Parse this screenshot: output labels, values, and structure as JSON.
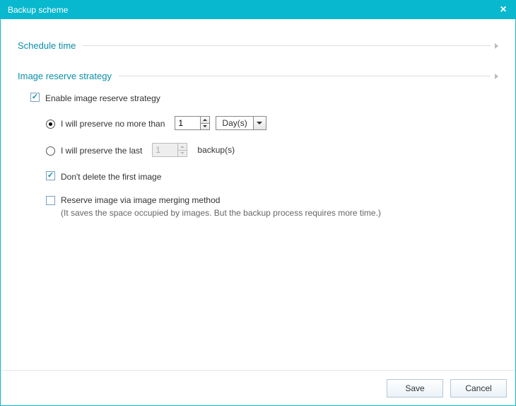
{
  "window": {
    "title": "Backup scheme"
  },
  "sections": {
    "schedule": {
      "title": "Schedule time"
    },
    "reserve": {
      "title": "Image reserve strategy",
      "enable_label": "Enable image reserve strategy",
      "enable_checked": true,
      "preserve_nomore": {
        "label": "I will preserve no more than",
        "selected": true,
        "value": "1",
        "unit": "Day(s)"
      },
      "preserve_last": {
        "label": "I will preserve the last",
        "selected": false,
        "value": "1",
        "suffix": "backup(s)"
      },
      "dont_delete_first": {
        "label": "Don't delete the first image",
        "checked": true
      },
      "merging": {
        "label": "Reserve image via image merging method",
        "note": "(It saves the space occupied by images. But the backup process requires more time.)",
        "checked": false
      }
    }
  },
  "footer": {
    "save": "Save",
    "cancel": "Cancel"
  }
}
